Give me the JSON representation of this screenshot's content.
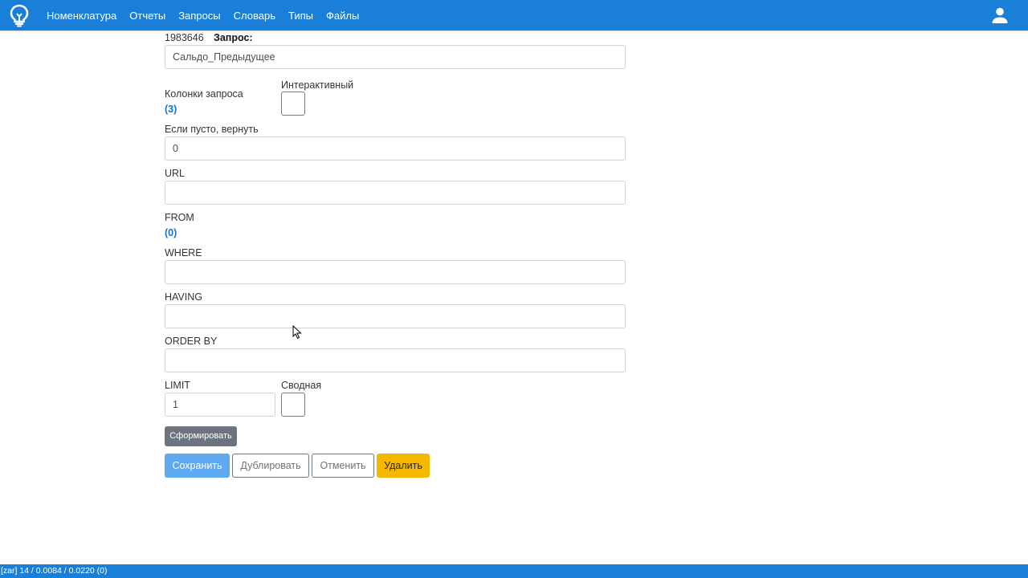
{
  "navbar": {
    "items": [
      "Номенклатура",
      "Отчеты",
      "Запросы",
      "Словарь",
      "Типы",
      "Файлы"
    ]
  },
  "form": {
    "record_id": "1983646",
    "query_label": "Запрос:",
    "query_value": "Сальдо_Предыдущее",
    "columns_label": "Колонки запроса",
    "columns_count": "(3)",
    "interactive_label": "Интерактивный",
    "interactive_checked": false,
    "if_empty_label": "Если пусто, вернуть",
    "if_empty_value": "0",
    "url_label": "URL",
    "url_value": "",
    "from_label": "FROM",
    "from_count": "(0)",
    "where_label": "WHERE",
    "where_value": "",
    "having_label": "HAVING",
    "having_value": "",
    "order_by_label": "ORDER BY",
    "order_by_value": "",
    "limit_label": "LIMIT",
    "limit_value": "1",
    "pivot_label": "Сводная",
    "pivot_checked": false
  },
  "buttons": {
    "generate": "Сформировать",
    "save": "Сохранить",
    "duplicate": "Дублировать",
    "cancel": "Отменить",
    "delete": "Удалить"
  },
  "statusbar": {
    "text": "[zar] 14 / 0.0084 / 0.0220 (0)"
  },
  "colors": {
    "navbar": "#1a7fd8",
    "save_button": "#5fa8f2",
    "delete_button": "#f5b800",
    "generate_button": "#6c757d",
    "link": "#1a6fc2"
  },
  "icons": {
    "logo": "lightbulb-logo-icon",
    "user": "user-icon"
  }
}
